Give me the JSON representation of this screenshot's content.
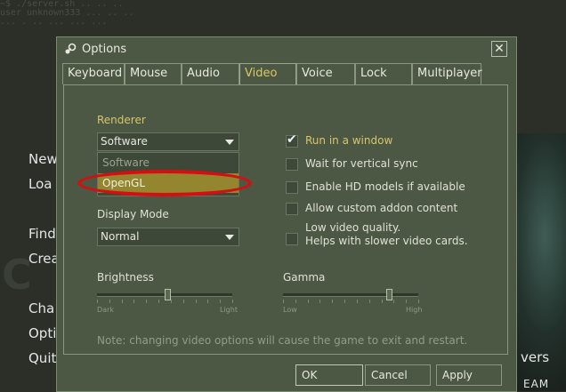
{
  "background": {
    "console_lines": [
      "~$ ./server.sh   ..   ..   ..",
      "user unknown333  ...  ..   ..",
      "... . .. ... ... ..."
    ],
    "menu_items": [
      "New",
      "Loa",
      "Find",
      "Crea",
      "Cha",
      "Opti",
      "Quit"
    ],
    "right_text_1": "vers",
    "right_text_2": "EAM",
    "big_text": "C"
  },
  "dialog": {
    "title": "Options",
    "close_glyph": "✕"
  },
  "tabs": [
    {
      "label": "Keyboard",
      "active": false
    },
    {
      "label": "Mouse",
      "active": false
    },
    {
      "label": "Audio",
      "active": false
    },
    {
      "label": "Video",
      "active": true
    },
    {
      "label": "Voice",
      "active": false
    },
    {
      "label": "Lock",
      "active": false
    },
    {
      "label": "Multiplayer",
      "active": false
    }
  ],
  "video": {
    "renderer_label": "Renderer",
    "renderer_value": "Software",
    "renderer_options": [
      "Software",
      "OpenGL"
    ],
    "renderer_highlighted": "OpenGL",
    "display_mode_label": "Display Mode",
    "display_mode_value": "Normal",
    "checkboxes": {
      "run_in_window": {
        "label": "Run in a window",
        "checked": true
      },
      "vsync": {
        "label": "Wait for vertical sync",
        "checked": false
      },
      "hd_models": {
        "label": "Enable HD models if available",
        "checked": false
      },
      "addon_content": {
        "label": "Allow custom addon content",
        "checked": false
      },
      "low_quality": {
        "label_line1": "Low video quality.",
        "label_line2": "Helps with slower video cards.",
        "checked": false
      }
    },
    "brightness": {
      "label": "Brightness",
      "min_label": "Dark",
      "max_label": "Light",
      "level": 0.52
    },
    "gamma": {
      "label": "Gamma",
      "min_label": "Low",
      "max_label": "High",
      "level": 0.78
    },
    "note": "Note: changing video options will cause the game to exit and restart."
  },
  "buttons": {
    "ok": "OK",
    "cancel": "Cancel",
    "apply": "Apply"
  },
  "colors": {
    "accent_gold": "#d7c56a",
    "highlight_olive": "#94862e",
    "annotation_red": "#d40f12"
  }
}
